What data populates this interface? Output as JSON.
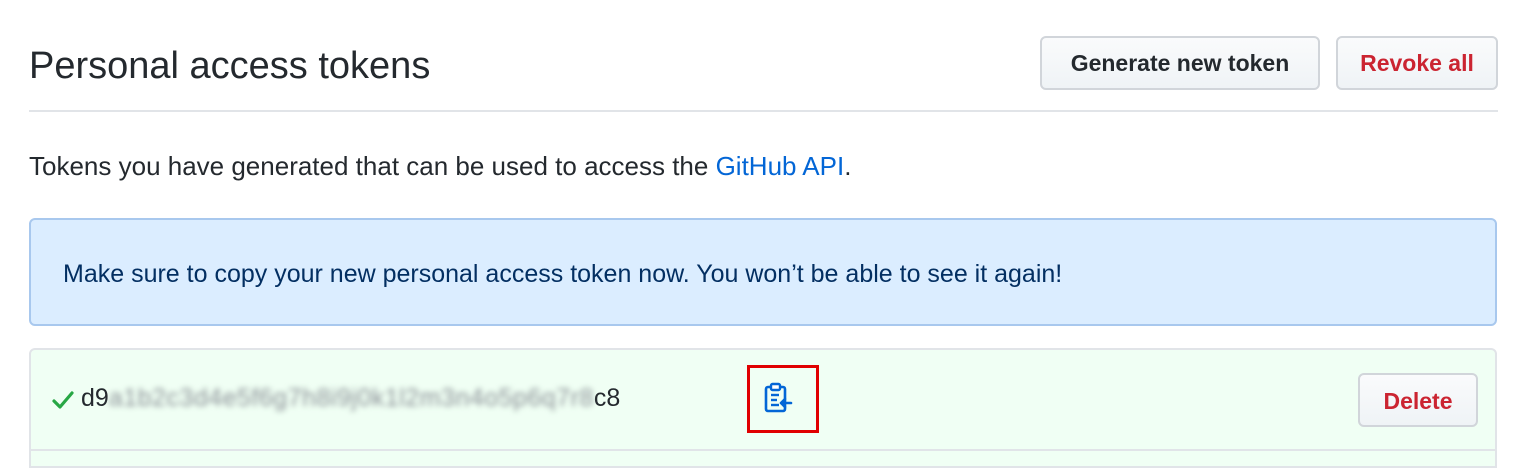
{
  "header": {
    "title": "Personal access tokens",
    "generate_label": "Generate new token",
    "revoke_label": "Revoke all"
  },
  "intro": {
    "text_before": "Tokens you have generated that can be used to access the ",
    "link_text": "GitHub API",
    "text_after": "."
  },
  "flash": {
    "message": "Make sure to copy your new personal access token now. You won’t be able to see it again!"
  },
  "token": {
    "prefix": "d9",
    "masked": "a1b2c3d4e5f6g7h8i9j0k1l2m3n4o5p6q7r8",
    "suffix": "c8",
    "delete_label": "Delete"
  },
  "icons": {
    "check": "check-icon",
    "copy": "clippy-icon"
  },
  "colors": {
    "accent_link": "#0366d6",
    "danger": "#cb2431",
    "success": "#28a745",
    "flash_bg": "#dbedff",
    "token_bg": "#f0fff4",
    "highlight": "#e00000"
  }
}
